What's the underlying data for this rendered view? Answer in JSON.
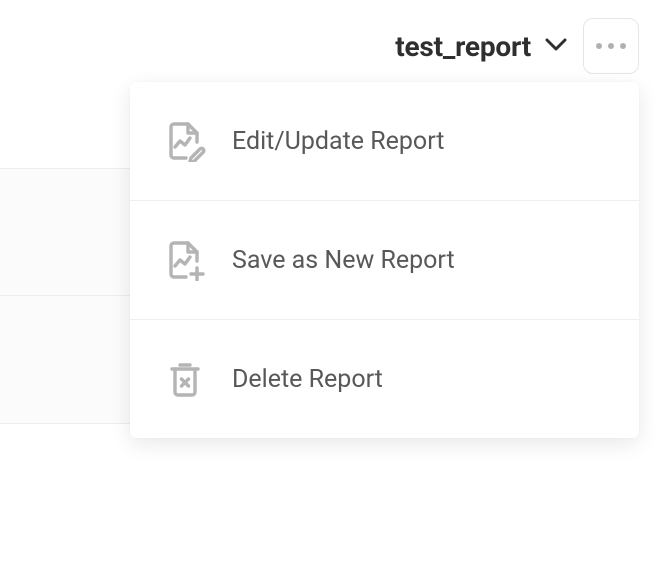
{
  "header": {
    "report_name": "test_report"
  },
  "menu": {
    "items": [
      {
        "label": "Edit/Update Report"
      },
      {
        "label": "Save as New Report"
      },
      {
        "label": "Delete Report"
      }
    ]
  }
}
